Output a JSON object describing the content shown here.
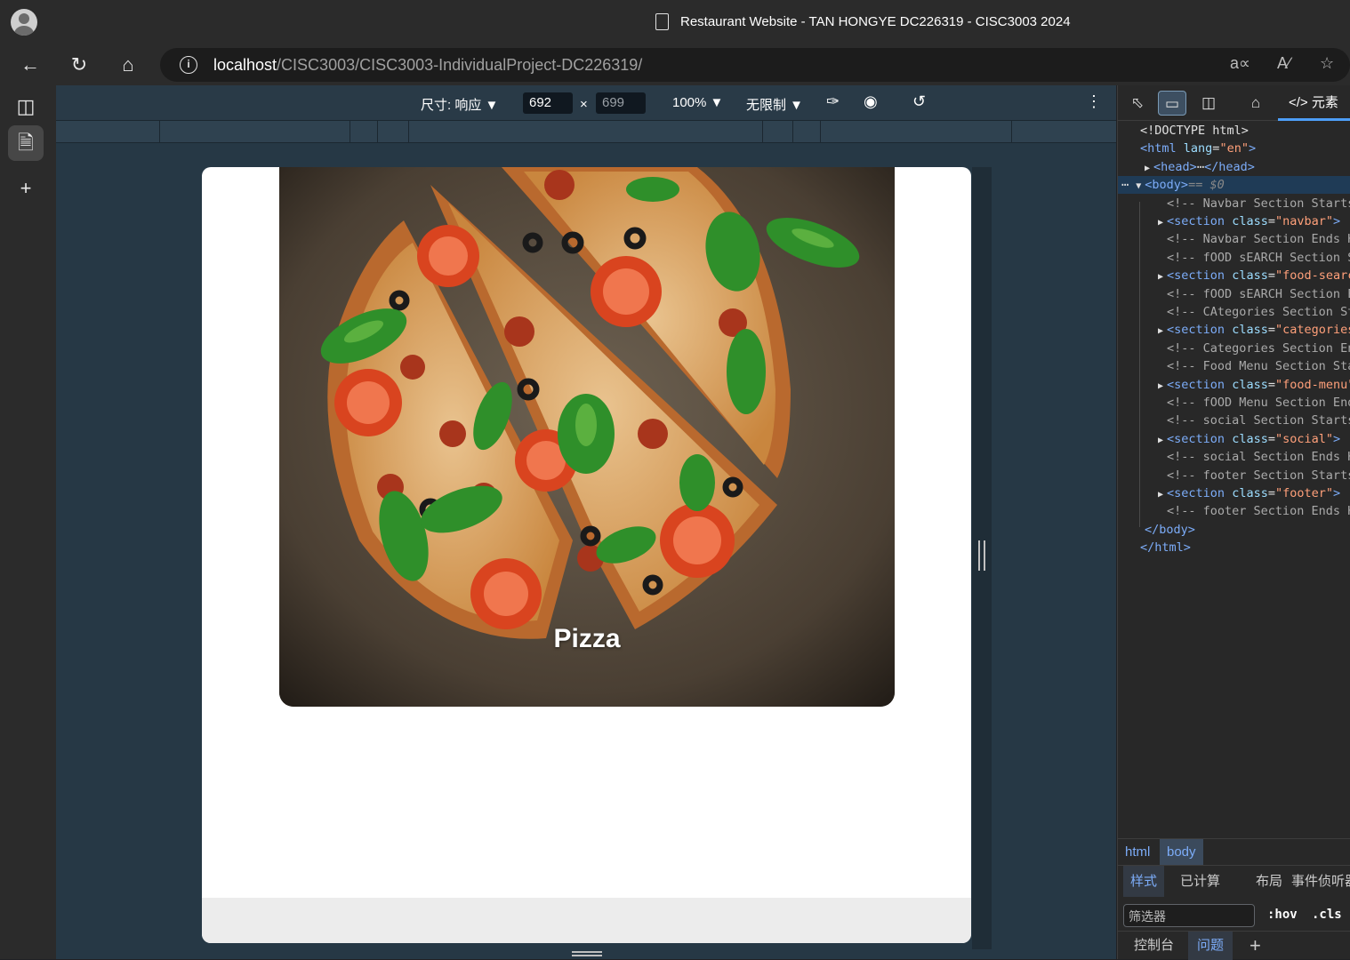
{
  "browser": {
    "window_title": "Restaurant Website - TAN HONGYE DC226319 - CISC3003 2024",
    "url_host": "localhost",
    "url_path": "/CISC3003/CISC3003-IndividualProject-DC226319/"
  },
  "device_toolbar": {
    "dimensions_label": "尺寸: 响应",
    "width": "692",
    "height": "699",
    "zoom": "100%",
    "throttle": "无限制"
  },
  "page": {
    "card_label": "Pizza"
  },
  "devtools": {
    "elements_tab": "元素",
    "dom": [
      {
        "indent": 0,
        "kind": "doctype",
        "text": "<!DOCTYPE html>"
      },
      {
        "indent": 0,
        "kind": "open",
        "tag": "html",
        "attr": "lang",
        "val": "\"en\""
      },
      {
        "indent": 1,
        "kind": "collapsed",
        "tag": "head"
      },
      {
        "indent": 1,
        "kind": "body",
        "tag": "body",
        "note": "== $0"
      },
      {
        "indent": 2,
        "kind": "comment",
        "text": "<!-- Navbar Section Starts -->"
      },
      {
        "indent": 2,
        "kind": "section",
        "val": "\"navbar\""
      },
      {
        "indent": 2,
        "kind": "comment",
        "text": "<!-- Navbar Section Ends Here -->"
      },
      {
        "indent": 2,
        "kind": "comment",
        "text": "<!-- fOOD sEARCH Section Starts Here -->"
      },
      {
        "indent": 2,
        "kind": "section",
        "val": "\"food-search text-center\""
      },
      {
        "indent": 2,
        "kind": "comment",
        "text": "<!-- fOOD sEARCH Section Ends Here -->"
      },
      {
        "indent": 2,
        "kind": "comment",
        "text": "<!-- CAtegories Section Starts Here -->"
      },
      {
        "indent": 2,
        "kind": "section",
        "val": "\"categories\""
      },
      {
        "indent": 2,
        "kind": "comment",
        "text": "<!-- Categories Section Ends Here -->"
      },
      {
        "indent": 2,
        "kind": "comment",
        "text": "<!-- Food Menu Section Starts Here -->"
      },
      {
        "indent": 2,
        "kind": "section",
        "val": "\"food-menu\""
      },
      {
        "indent": 2,
        "kind": "comment",
        "text": "<!-- fOOD Menu Section Ends Here -->"
      },
      {
        "indent": 2,
        "kind": "comment",
        "text": "<!-- social Section Starts Here -->"
      },
      {
        "indent": 2,
        "kind": "section",
        "val": "\"social\""
      },
      {
        "indent": 2,
        "kind": "comment",
        "text": "<!-- social Section Ends Here -->"
      },
      {
        "indent": 2,
        "kind": "comment",
        "text": "<!-- footer Section Starts Here -->"
      },
      {
        "indent": 2,
        "kind": "section",
        "val": "\"footer\""
      },
      {
        "indent": 2,
        "kind": "comment",
        "text": "<!-- footer Section Ends Here -->"
      },
      {
        "indent": 1,
        "kind": "close",
        "text": "</body>"
      },
      {
        "indent": 0,
        "kind": "close",
        "text": "</html>"
      }
    ],
    "crumbs": [
      "html",
      "body"
    ],
    "style_tabs": [
      "样式",
      "已计算",
      "布局",
      "事件侦听器"
    ],
    "filter_placeholder": "筛选器",
    "hov": ":hov",
    "cls": ".cls",
    "console_tabs": [
      "控制台",
      "问题"
    ]
  },
  "colors": {
    "accent": "#4d9ef7",
    "tag": "#7cacf8",
    "attr_value": "#ffa07a"
  }
}
